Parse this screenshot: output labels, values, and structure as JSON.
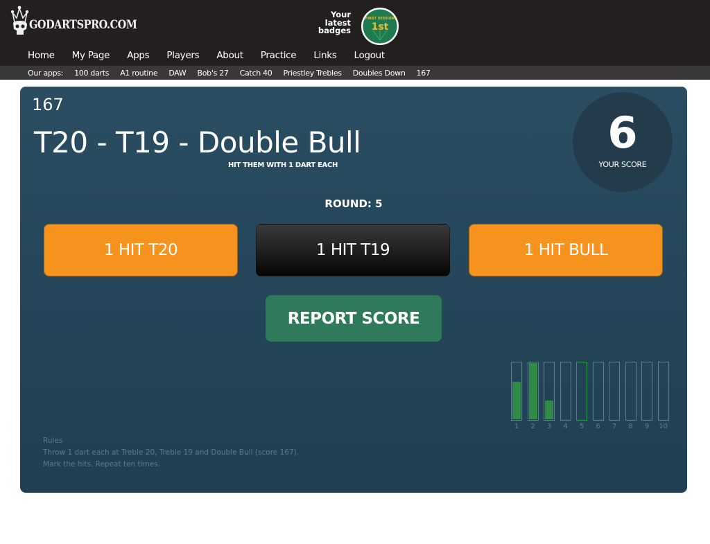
{
  "header": {
    "site_name": "GODARTSPRO.COM",
    "badges_label": [
      "Your",
      "latest",
      "badges"
    ],
    "badge": {
      "top_text": "FIRST SESSION",
      "rank": "1st",
      "colors": {
        "fill": "#1f7a4f",
        "text": "#f0b92b",
        "ring": "#ffffff"
      }
    },
    "nav": [
      "Home",
      "My Page",
      "Apps",
      "Players",
      "About",
      "Practice",
      "Links",
      "Logout"
    ]
  },
  "apps_bar": {
    "label": "Our apps:",
    "items": [
      "100 darts",
      "A1 routine",
      "DAW",
      "Bob's 27",
      "Catch 40",
      "Priestley Trebles",
      "Doubles Down",
      "167"
    ]
  },
  "game": {
    "number": "167",
    "title": "T20 - T19 - Double Bull",
    "subtitle": "HIT THEM WITH 1 DART EACH",
    "score": "6",
    "score_label": "YOUR SCORE",
    "round_text": "ROUND: 5",
    "buttons": [
      {
        "label": "1 HIT T20",
        "state": "selected",
        "color": "#f6931f"
      },
      {
        "label": "1 HIT T19",
        "state": "unselected",
        "color": "#1a1a1a"
      },
      {
        "label": "1 HIT BULL",
        "state": "selected",
        "color": "#f6931f"
      }
    ],
    "report_label": "REPORT SCORE",
    "rules": {
      "heading": "Rules",
      "lines": [
        "Throw 1 dart each at Treble 20, Treble 19 and Double Bull (score 167).",
        "Mark the hits. Repeat ten times."
      ]
    }
  },
  "chart_data": {
    "type": "bar",
    "title": "",
    "categories": [
      "1",
      "2",
      "3",
      "4",
      "5",
      "6",
      "7",
      "8",
      "9",
      "10"
    ],
    "values": [
      2,
      3,
      1,
      0,
      0,
      0,
      0,
      0,
      0,
      0
    ],
    "ylim": [
      0,
      3
    ],
    "current_round": 5,
    "xlabel": "",
    "ylabel": "",
    "grid": false,
    "colors": {
      "fill": "#2f8b47",
      "outline": "#5f7e90",
      "current_outline": "#2ea04a"
    }
  }
}
